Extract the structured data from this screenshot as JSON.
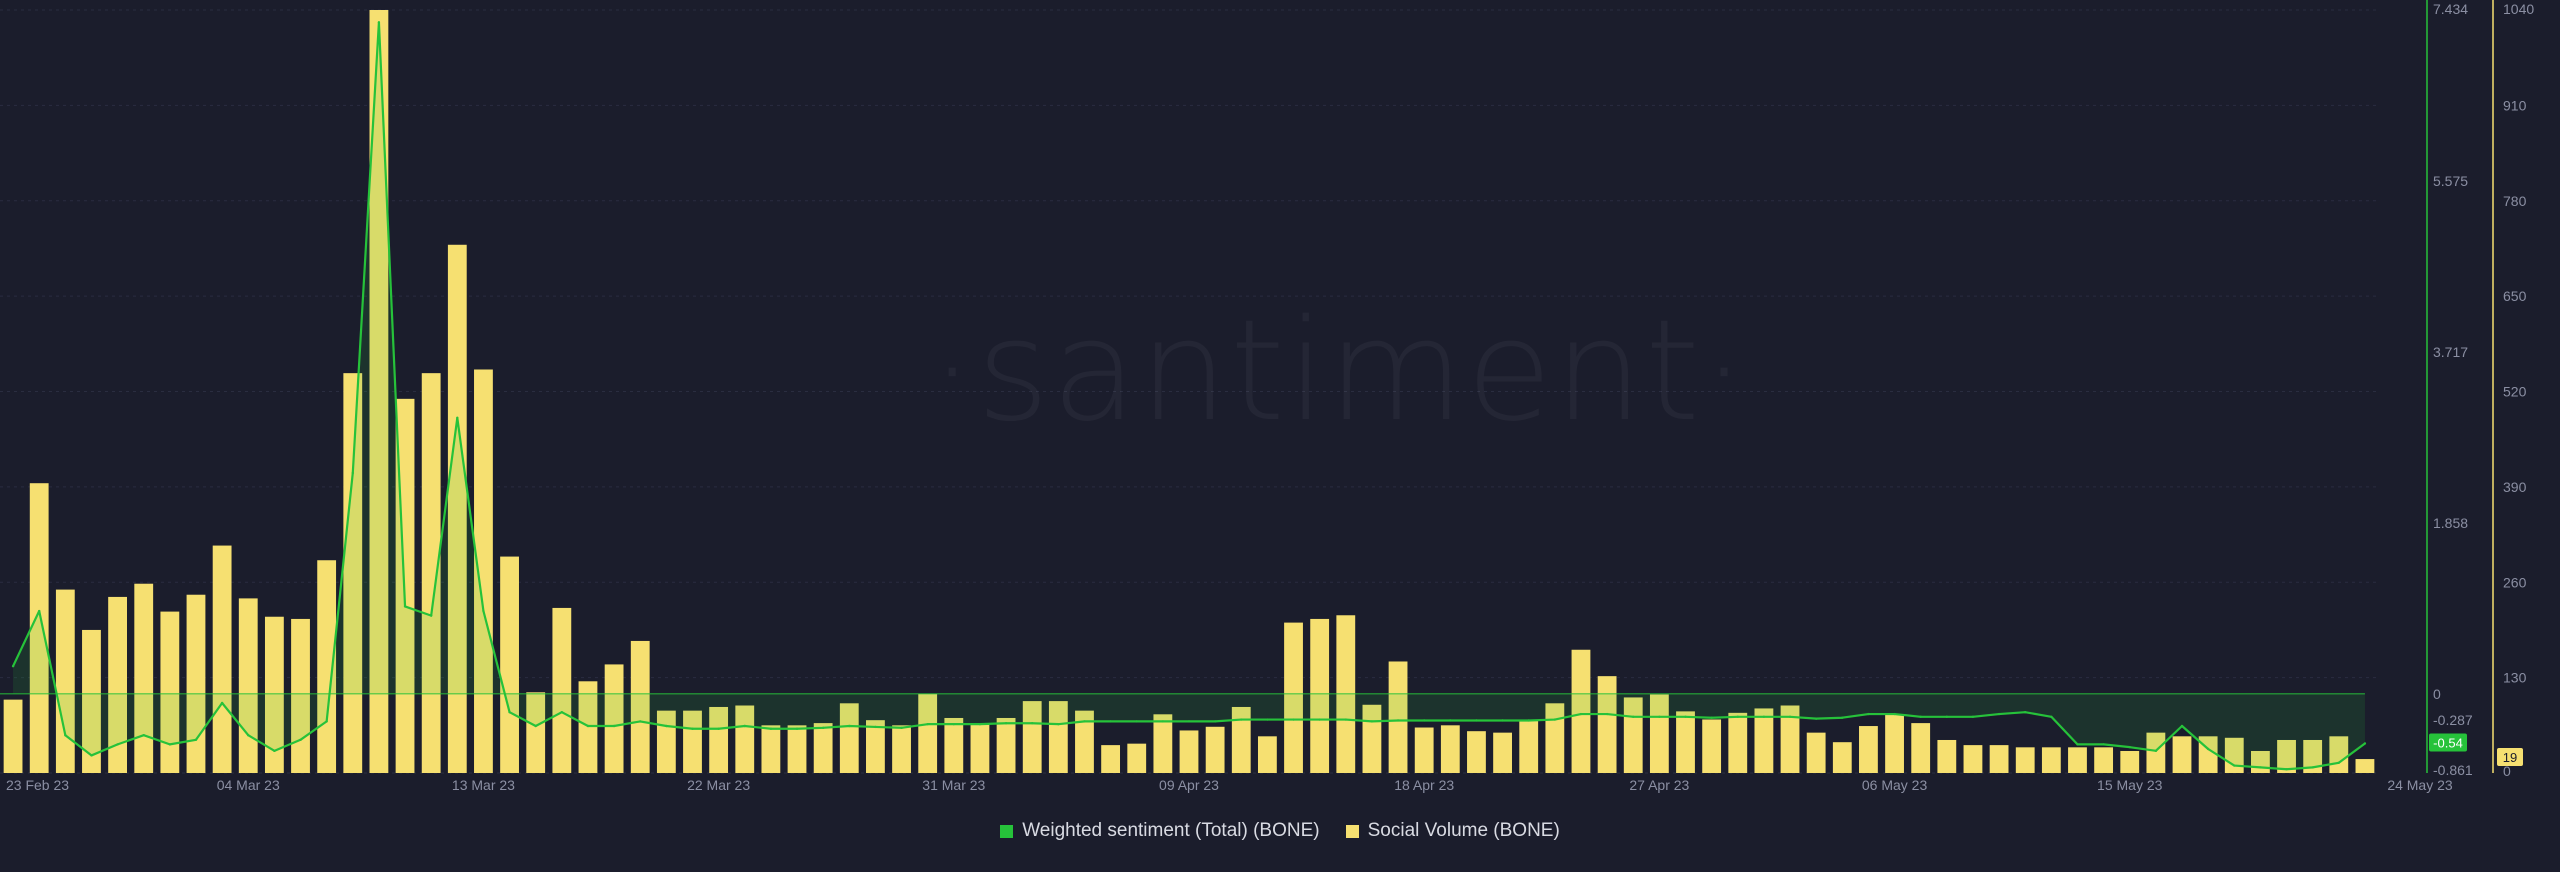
{
  "watermark": "·santiment·",
  "legend": [
    {
      "label": "Weighted sentiment (Total) (BONE)",
      "color": "#26c23a"
    },
    {
      "label": "Social Volume (BONE)",
      "color": "#f6e071"
    }
  ],
  "chart_data": {
    "type": "bar",
    "x_ticks": [
      "23 Feb 23",
      "04 Mar 23",
      "13 Mar 23",
      "22 Mar 23",
      "31 Mar 23",
      "09 Apr 23",
      "18 Apr 23",
      "27 Apr 23",
      "06 May 23",
      "15 May 23",
      "24 May 23"
    ],
    "left_axis": {
      "ticks": [
        "7.434",
        "5.575",
        "3.717",
        "1.858",
        "0",
        "-0.287",
        "-0.861"
      ],
      "ylim": [
        -0.861,
        7.434
      ],
      "color": "#26c23a"
    },
    "right_axis": {
      "ticks": [
        "1040",
        "910",
        "780",
        "650",
        "520",
        "390",
        "260",
        "130",
        "0"
      ],
      "ylim": [
        0,
        1040
      ],
      "color": "#f6e071"
    },
    "series": [
      {
        "name": "Social Volume (BONE)",
        "type": "bar",
        "axis": "right",
        "color": "#f6e071",
        "values": [
          100,
          395,
          250,
          195,
          240,
          258,
          220,
          243,
          310,
          238,
          213,
          210,
          290,
          545,
          1040,
          510,
          545,
          720,
          550,
          295,
          110,
          225,
          125,
          148,
          180,
          85,
          85,
          90,
          92,
          65,
          65,
          68,
          95,
          72,
          65,
          108,
          75,
          68,
          75,
          98,
          98,
          85,
          38,
          40,
          80,
          58,
          63,
          90,
          50,
          205,
          210,
          215,
          93,
          152,
          62,
          65,
          57,
          55,
          72,
          95,
          168,
          132,
          103,
          107,
          84,
          73,
          82,
          88,
          92,
          55,
          42,
          64,
          80,
          68,
          45,
          38,
          38,
          35,
          35,
          35,
          35,
          30,
          55,
          50,
          50,
          48,
          30,
          45,
          45,
          50,
          19
        ]
      },
      {
        "name": "Weighted sentiment (Total) (BONE)",
        "type": "line",
        "axis": "left",
        "color": "#26c23a",
        "values": [
          0.3,
          0.9,
          -0.45,
          -0.67,
          -0.55,
          -0.45,
          -0.55,
          -0.5,
          -0.1,
          -0.45,
          -0.62,
          -0.5,
          -0.3,
          2.4,
          7.3,
          0.95,
          0.85,
          3.0,
          0.9,
          -0.2,
          -0.35,
          -0.2,
          -0.35,
          -0.35,
          -0.3,
          -0.35,
          -0.38,
          -0.38,
          -0.35,
          -0.38,
          -0.38,
          -0.37,
          -0.35,
          -0.36,
          -0.37,
          -0.33,
          -0.33,
          -0.33,
          -0.32,
          -0.32,
          -0.33,
          -0.3,
          -0.3,
          -0.3,
          -0.3,
          -0.3,
          -0.3,
          -0.28,
          -0.28,
          -0.28,
          -0.28,
          -0.28,
          -0.3,
          -0.29,
          -0.29,
          -0.29,
          -0.29,
          -0.29,
          -0.29,
          -0.28,
          -0.22,
          -0.22,
          -0.25,
          -0.25,
          -0.25,
          -0.26,
          -0.25,
          -0.25,
          -0.25,
          -0.27,
          -0.26,
          -0.22,
          -0.22,
          -0.25,
          -0.25,
          -0.25,
          -0.22,
          -0.2,
          -0.25,
          -0.55,
          -0.55,
          -0.58,
          -0.62,
          -0.35,
          -0.6,
          -0.78,
          -0.8,
          -0.82,
          -0.8,
          -0.75,
          -0.54
        ]
      }
    ],
    "last_value_labels": {
      "sentiment": "-0.54",
      "social_volume": "19"
    }
  }
}
